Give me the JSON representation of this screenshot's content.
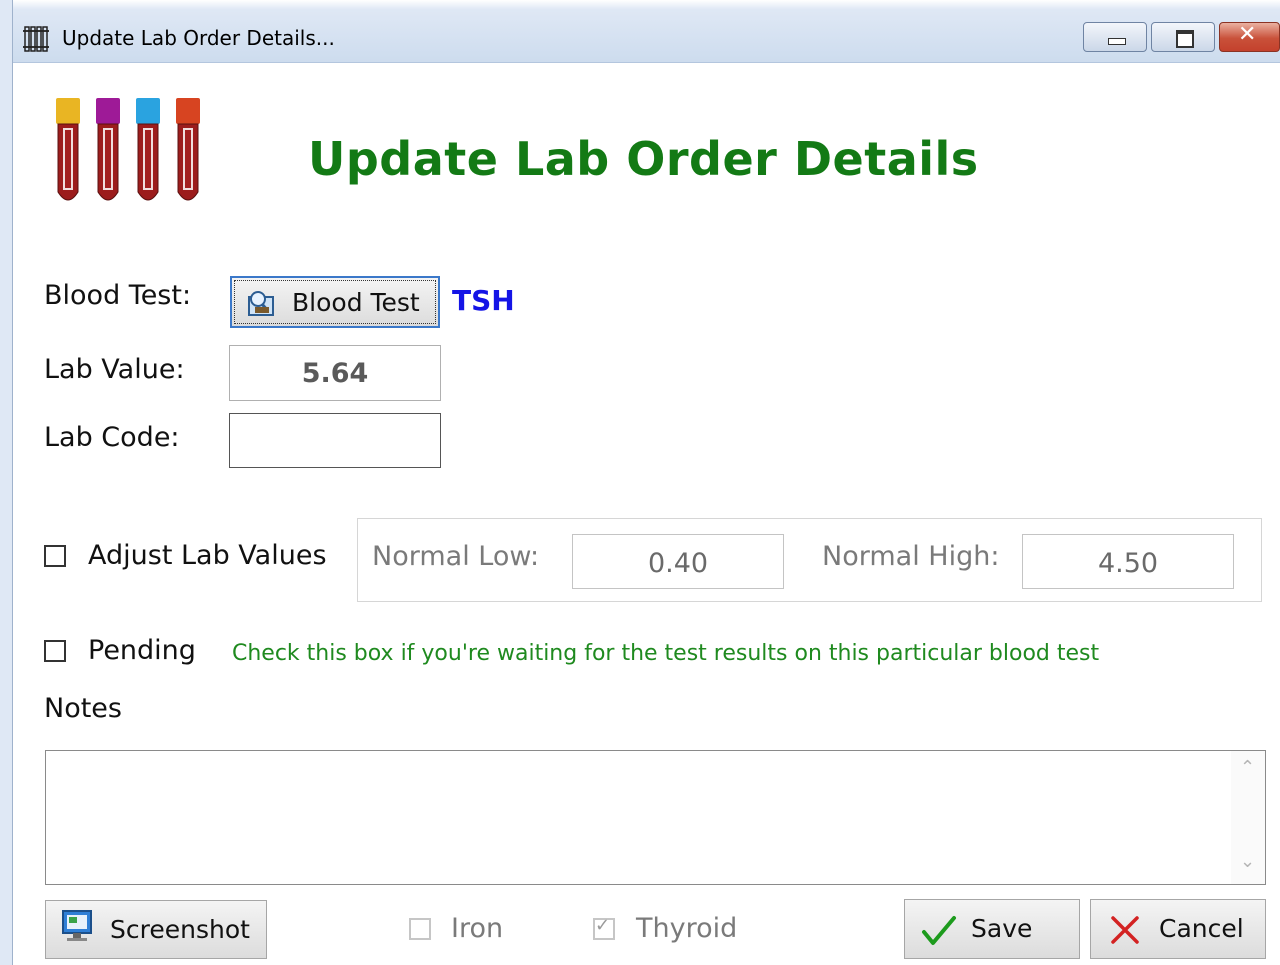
{
  "window": {
    "title": "Update Lab Order Details...",
    "icon": "test-tubes-icon",
    "controls": [
      "minimize-icon",
      "restore-icon",
      "close-icon"
    ]
  },
  "heading": "Update Lab Order Details",
  "tube_colors": [
    "#e9b523",
    "#9e1a97",
    "#2aa3e0",
    "#d74421"
  ],
  "form": {
    "blood_test_label": "Blood Test:",
    "blood_test_button": "Blood Test",
    "blood_test_value": "TSH",
    "lab_value_label": "Lab Value:",
    "lab_value": "5.64",
    "lab_code_label": "Lab Code:",
    "lab_code": ""
  },
  "adjust": {
    "label": "Adjust Lab Values",
    "checked": false,
    "normal_low_label": "Normal Low:",
    "normal_low": "0.40",
    "normal_high_label": "Normal High:",
    "normal_high": "4.50"
  },
  "pending": {
    "label": "Pending",
    "checked": false,
    "hint": "Check this box if you're waiting for the test results on this particular blood test"
  },
  "notes": {
    "label": "Notes",
    "value": ""
  },
  "footer": {
    "screenshot_button": "Screenshot",
    "iron_label": "Iron",
    "iron_checked": false,
    "thyroid_label": "Thyroid",
    "thyroid_checked": true,
    "save_button": "Save",
    "cancel_button": "Cancel"
  },
  "colors": {
    "heading": "#137a15",
    "test_value": "#1414e6",
    "hint": "#1f8a1f",
    "save_check": "#1d9b1d",
    "cancel_x": "#d32222"
  }
}
